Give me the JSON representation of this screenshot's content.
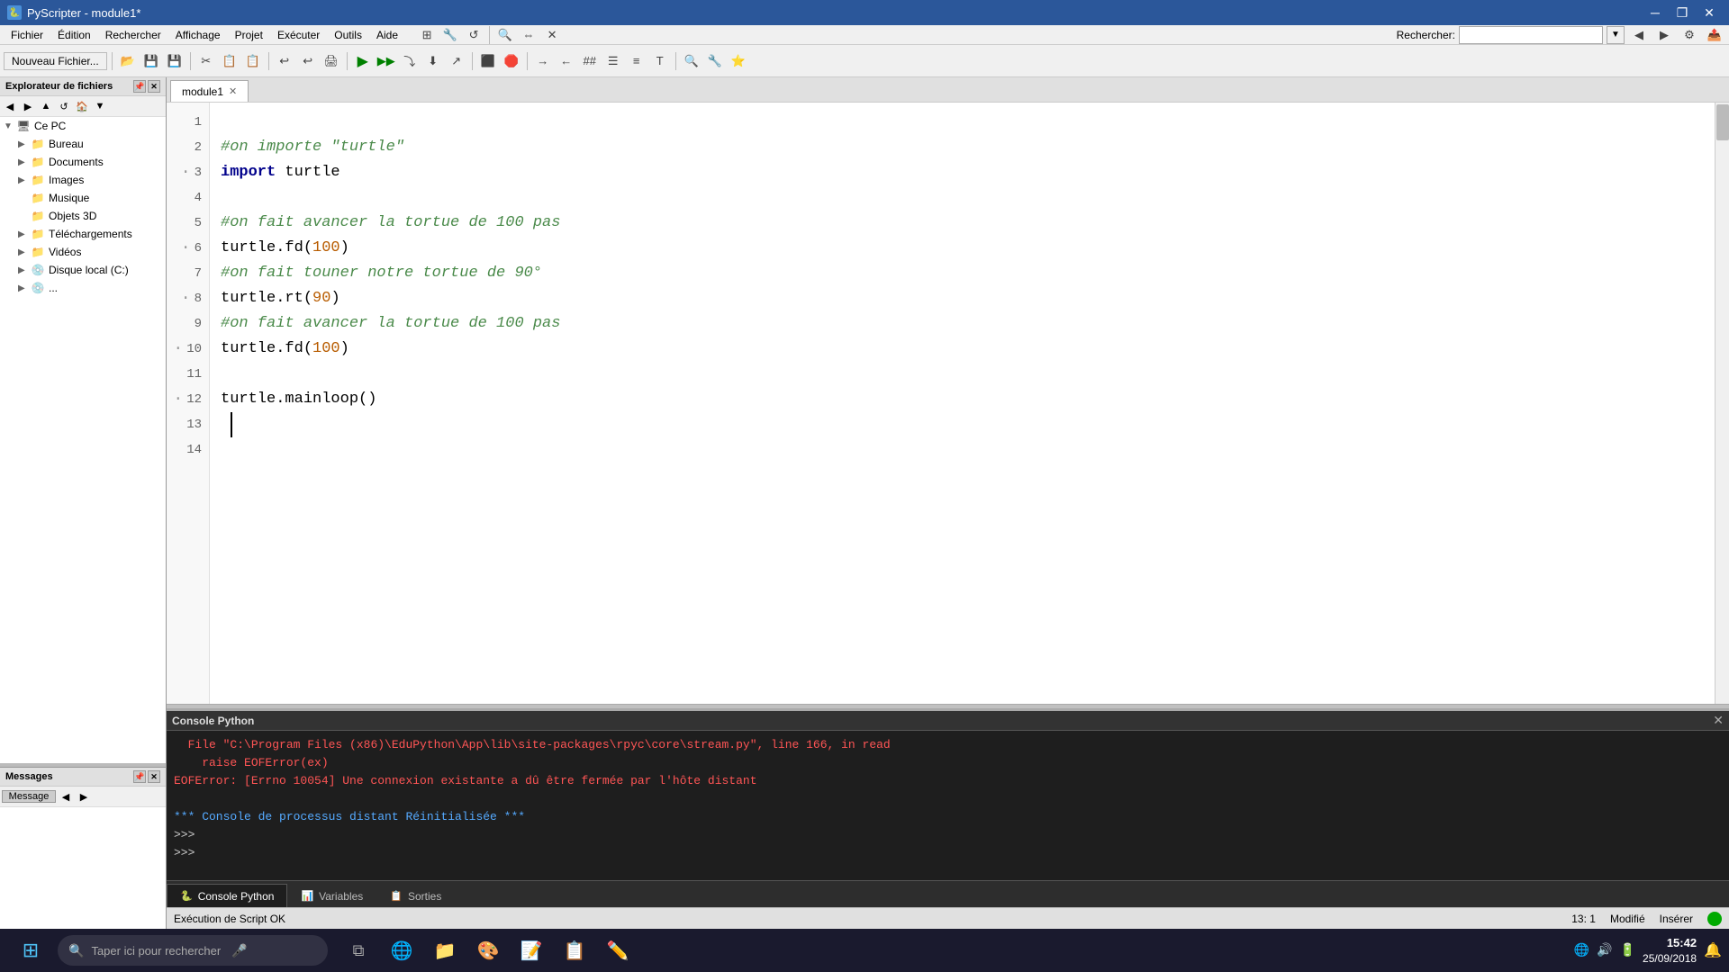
{
  "titleBar": {
    "title": "PyScripter - module1*",
    "icon": "🐍",
    "controls": {
      "minimize": "─",
      "restore": "❐",
      "close": "✕"
    }
  },
  "menuBar": {
    "items": [
      "Fichier",
      "Édition",
      "Rechercher",
      "Affichage",
      "Projet",
      "Exécuter",
      "Outils",
      "Aide"
    ]
  },
  "toolbar": {
    "newFile": "Nouveau Fichier...",
    "searchLabel": "Rechercher:",
    "searchPlaceholder": ""
  },
  "sidebar": {
    "title": "Explorateur de fichiers",
    "treeItems": [
      {
        "label": "Ce PC",
        "indent": 0,
        "expanded": true,
        "type": "computer"
      },
      {
        "label": "Bureau",
        "indent": 1,
        "expanded": false,
        "type": "folder"
      },
      {
        "label": "Documents",
        "indent": 1,
        "expanded": false,
        "type": "folder"
      },
      {
        "label": "Images",
        "indent": 1,
        "expanded": false,
        "type": "folder"
      },
      {
        "label": "Musique",
        "indent": 1,
        "expanded": false,
        "type": "folder"
      },
      {
        "label": "Objets 3D",
        "indent": 1,
        "expanded": false,
        "type": "folder"
      },
      {
        "label": "Téléchargements",
        "indent": 1,
        "expanded": false,
        "type": "folder"
      },
      {
        "label": "Vidéos",
        "indent": 1,
        "expanded": false,
        "type": "folder"
      },
      {
        "label": "Disque local (C:)",
        "indent": 1,
        "expanded": false,
        "type": "drive"
      }
    ]
  },
  "messagesPanel": {
    "title": "Messages",
    "column": "Message"
  },
  "editorTabs": [
    {
      "label": "module1",
      "active": true,
      "closeable": true
    }
  ],
  "codeLines": [
    {
      "num": 1,
      "hasDot": false,
      "content": [],
      "raw": ""
    },
    {
      "num": 2,
      "hasDot": false,
      "content": [
        {
          "type": "comment",
          "text": "#on importe \"turtle\""
        }
      ],
      "raw": "#on importe \"turtle\""
    },
    {
      "num": 3,
      "hasDot": true,
      "content": [
        {
          "type": "keyword",
          "text": "import"
        },
        {
          "type": "normal",
          "text": " turtle"
        }
      ],
      "raw": "import turtle"
    },
    {
      "num": 4,
      "hasDot": false,
      "content": [],
      "raw": ""
    },
    {
      "num": 5,
      "hasDot": false,
      "content": [
        {
          "type": "comment",
          "text": "#on fait avancer la tortue de 100 pas"
        }
      ],
      "raw": "#on fait avancer la tortue de 100 pas"
    },
    {
      "num": 6,
      "hasDot": true,
      "content": [
        {
          "type": "normal",
          "text": "turtle.fd("
        },
        {
          "type": "number",
          "text": "100"
        },
        {
          "type": "normal",
          "text": ")"
        }
      ],
      "raw": "turtle.fd(100)"
    },
    {
      "num": 7,
      "hasDot": false,
      "content": [
        {
          "type": "comment",
          "text": "#on fait touner notre tortue de 90°"
        }
      ],
      "raw": "#on fait touner notre tortue de 90°"
    },
    {
      "num": 8,
      "hasDot": true,
      "content": [
        {
          "type": "normal",
          "text": "turtle.rt("
        },
        {
          "type": "number",
          "text": "90"
        },
        {
          "type": "normal",
          "text": ")"
        }
      ],
      "raw": "turtle.rt(90)"
    },
    {
      "num": 9,
      "hasDot": false,
      "content": [
        {
          "type": "comment",
          "text": "#on fait avancer la tortue de 100 pas"
        }
      ],
      "raw": "#on fait avancer la tortue de 100 pas"
    },
    {
      "num": 10,
      "hasDot": true,
      "content": [
        {
          "type": "normal",
          "text": "turtle.fd("
        },
        {
          "type": "number",
          "text": "100"
        },
        {
          "type": "normal",
          "text": ")"
        }
      ],
      "raw": "turtle.fd(100)"
    },
    {
      "num": 11,
      "hasDot": false,
      "content": [],
      "raw": ""
    },
    {
      "num": 12,
      "hasDot": true,
      "content": [
        {
          "type": "normal",
          "text": "turtle.mainloop()"
        }
      ],
      "raw": "turtle.mainloop()"
    },
    {
      "num": 13,
      "hasDot": false,
      "content": [
        {
          "type": "cursor",
          "text": ""
        }
      ],
      "raw": ""
    },
    {
      "num": 14,
      "hasDot": false,
      "content": [],
      "raw": ""
    }
  ],
  "consolePanel": {
    "title": "Console Python",
    "closeBtn": "✕",
    "lines": [
      {
        "type": "error",
        "text": "  File \"C:\\Program Files (x86)\\EduPython\\App\\lib\\site-packages\\rpyc\\core\\stream.py\", line 166, in read"
      },
      {
        "type": "error",
        "text": "    raise EOFError(ex)"
      },
      {
        "type": "error",
        "text": "EOFError: [Errno 10054] Une connexion existante a dû être fermée par l'hôte distant"
      },
      {
        "type": "normal",
        "text": ""
      },
      {
        "type": "reset",
        "text": "*** Console de processus distant Réinitialisée ***"
      },
      {
        "type": "prompt",
        "text": ">>>"
      },
      {
        "type": "prompt",
        "text": ">>>"
      }
    ]
  },
  "bottomTabs": [
    {
      "label": "Console Python",
      "active": true,
      "icon": "🐍"
    },
    {
      "label": "Variables",
      "active": false,
      "icon": "📊"
    },
    {
      "label": "Sorties",
      "active": false,
      "icon": "📋"
    }
  ],
  "statusBar": {
    "status": "Exécution de Script OK",
    "position": "13: 1",
    "modified": "Modifié",
    "insertMode": "Insérer"
  },
  "taskbar": {
    "searchPlaceholder": "Taper ici pour rechercher",
    "time": "15:42",
    "date": "25/09/2018",
    "apps": [
      "🌐",
      "📁",
      "🎨",
      "📝",
      "📋",
      "✏️"
    ]
  }
}
